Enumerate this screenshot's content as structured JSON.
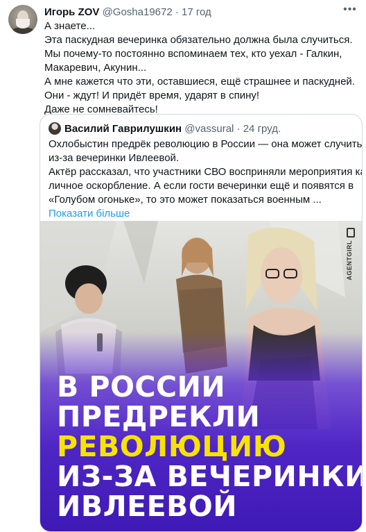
{
  "tweet": {
    "author_name": "Игорь ZOV",
    "handle": "@Gosha19672",
    "separator": "·",
    "time": "17 год",
    "lines": [
      "А знаете...",
      "Эта паскудная вечеринка обязательно должна была случиться.",
      "Мы почему-то постоянно вспоминаем тех, кто уехал - Галкин,",
      "Макаревич, Акунин...",
      "А мне кажется что эти, оставшиеся, ещё страшнее и паскудней.",
      "Они - ждут! И придёт время, ударят в спину!",
      "Даже не сомневайтесь!"
    ]
  },
  "quoted": {
    "author_name": "Василий Гаврилушкин",
    "handle": "@vassural",
    "separator": "·",
    "time": "24 груд.",
    "lines": [
      "Охлобыстин предрёк революцию в России — она может случиться...",
      "из-за вечеринки Ивлеевой.",
      "Актёр рассказал, что участники СВО восприняли мероприятия как",
      "личное оскорбление. А если гости вечеринки ещё и появятся в",
      "«Голубом огоньке», то это может показаться военным ..."
    ],
    "show_more": "Показати більше"
  },
  "media": {
    "watermark": "AGENTGIRL",
    "headline_white": [
      "В РОССИИ",
      "ПРЕДРЕКЛИ"
    ],
    "headline_yellow": [
      "РЕВОЛЮЦИЮ",
      "ИЗ-ЗА ВЕЧЕРИНКИ",
      "ИВЛЕЕВОЙ"
    ],
    "headline_last_white": "ИВЛЕЕВОЙ"
  },
  "icons": {
    "more": "more-horizontal-icon",
    "verified": "none"
  },
  "colors": {
    "link": "#1d9bf0",
    "muted": "#536471",
    "headline_white": "#ffffff",
    "headline_yellow": "#f6e300",
    "overlay_purple": "#5b2bd9"
  }
}
